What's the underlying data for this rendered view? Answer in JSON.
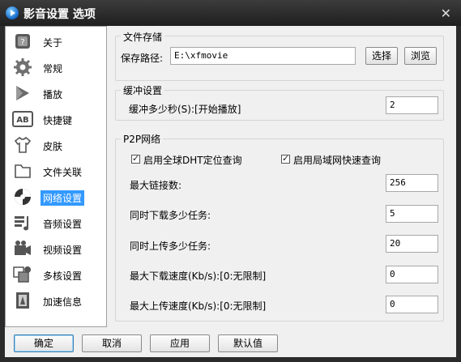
{
  "window": {
    "title": "影音设置 选项",
    "close_symbol": "✕"
  },
  "sidebar": {
    "items": [
      {
        "label": "关于",
        "icon": "about-icon"
      },
      {
        "label": "常规",
        "icon": "gear-icon"
      },
      {
        "label": "播放",
        "icon": "play-icon"
      },
      {
        "label": "快捷键",
        "icon": "keyboard-ab-icon"
      },
      {
        "label": "皮肤",
        "icon": "tshirt-icon"
      },
      {
        "label": "文件关联",
        "icon": "folder-icon"
      },
      {
        "label": "网络设置",
        "icon": "network-icon",
        "active": true
      },
      {
        "label": "音频设置",
        "icon": "audio-icon"
      },
      {
        "label": "视频设置",
        "icon": "video-icon"
      },
      {
        "label": "多核设置",
        "icon": "multicore-icon"
      },
      {
        "label": "加速信息",
        "icon": "accelerate-icon"
      }
    ]
  },
  "file_storage": {
    "title": "文件存储",
    "path_label": "保存路径:",
    "path_value": "E:\\xfmovie",
    "select_button": "选择",
    "browse_button": "浏览"
  },
  "buffer": {
    "title": "缓冲设置",
    "label": "缓冲多少秒(S):[开始播放]",
    "value": "2"
  },
  "p2p": {
    "title": "P2P网络",
    "enable_global_dht": {
      "label": "启用全球DHT定位查询",
      "checked": true
    },
    "enable_lan_fast": {
      "label": "启用局域网快速查询",
      "checked": true
    },
    "max_connections": {
      "label": "最大链接数:",
      "value": "256"
    },
    "max_download_tasks": {
      "label": "同时下载多少任务:",
      "value": "5"
    },
    "max_upload_tasks": {
      "label": "同时上传多少任务:",
      "value": "20"
    },
    "max_download_speed": {
      "label": "最大下载速度(Kb/s):[0:无限制]",
      "value": "0"
    },
    "max_upload_speed": {
      "label": "最大上传速度(Kb/s):[0:无限制]",
      "value": "0"
    }
  },
  "footer": {
    "ok": "确定",
    "cancel": "取消",
    "apply": "应用",
    "default": "默认值"
  },
  "colors": {
    "accent": "#3399ff",
    "titlebar": "#2b2b2b"
  }
}
